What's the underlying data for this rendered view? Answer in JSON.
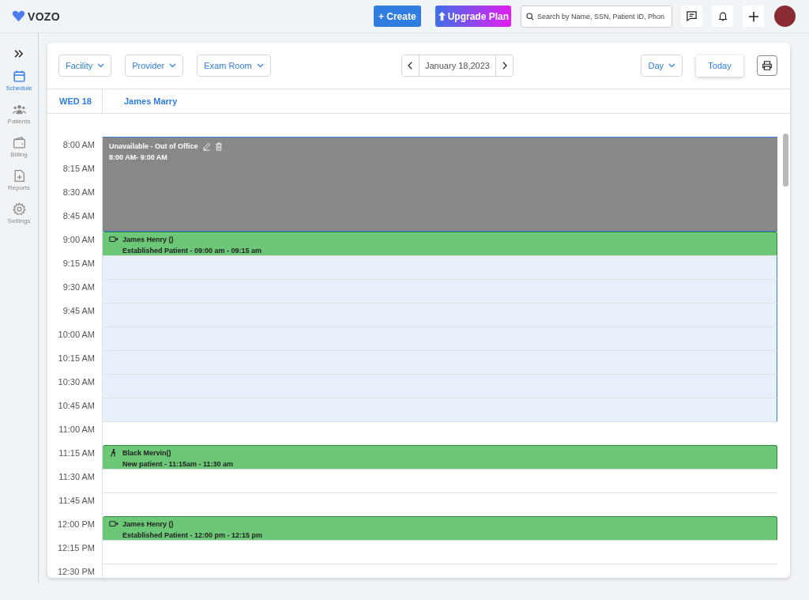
{
  "header": {
    "logo": "VOZO",
    "create_button": "+ Create",
    "upgrade_button": "Upgrade Plan",
    "search": {
      "placeholder": "Search by Name, SSN, Patient ID, Phon"
    }
  },
  "sidebar": {
    "items": [
      {
        "label": "Schedule",
        "selected": true
      },
      {
        "label": "Patients",
        "selected": false
      },
      {
        "label": "Billing",
        "selected": false
      },
      {
        "label": "Reports",
        "selected": false
      },
      {
        "label": "Settings",
        "selected": false
      }
    ]
  },
  "toolbar": {
    "filters": [
      "Facility",
      "Provider",
      "Exam Room"
    ],
    "date": "January 18,2023",
    "view": "Day",
    "today_button": "Today"
  },
  "day_header": {
    "day": "WED 18",
    "provider": "James Marry"
  },
  "slots": [
    {
      "time": "8:00 AM",
      "kind": "unavailable",
      "title": "Unavailable - Out of Office",
      "detail": "8:00 AM- 9:00 AM"
    },
    {
      "time": "8:15 AM",
      "kind": "unavailable"
    },
    {
      "time": "8:30 AM",
      "kind": "unavailable"
    },
    {
      "time": "8:45 AM",
      "kind": "unavailable"
    },
    {
      "time": "9:00 AM",
      "kind": "video-appointment",
      "title": "James Henry ()",
      "detail": "Established Patient - 09:00 am - 09:15 am"
    },
    {
      "time": "9:15 AM",
      "kind": "highlight"
    },
    {
      "time": "9:30 AM",
      "kind": "highlight"
    },
    {
      "time": "9:45 AM",
      "kind": "highlight"
    },
    {
      "time": "10:00 AM",
      "kind": "highlight"
    },
    {
      "time": "10:15 AM",
      "kind": "highlight"
    },
    {
      "time": "10:30 AM",
      "kind": "highlight"
    },
    {
      "time": "10:45 AM",
      "kind": "highlight"
    },
    {
      "time": "11:00 AM",
      "kind": "free"
    },
    {
      "time": "11:15 AM",
      "kind": "walk-in-appointment",
      "title": "Black Mervin()",
      "detail": "New patient - 11:15am - 11:30 am"
    },
    {
      "time": "11:30 AM",
      "kind": "free"
    },
    {
      "time": "11:45 AM",
      "kind": "free"
    },
    {
      "time": "12:00 PM",
      "kind": "video-appointment",
      "title": "James Henry ()",
      "detail": "Established Patient - 12:00 pm - 12:15 pm"
    },
    {
      "time": "12:15 PM",
      "kind": "free"
    },
    {
      "time": "12:30 PM",
      "kind": "free"
    }
  ]
}
